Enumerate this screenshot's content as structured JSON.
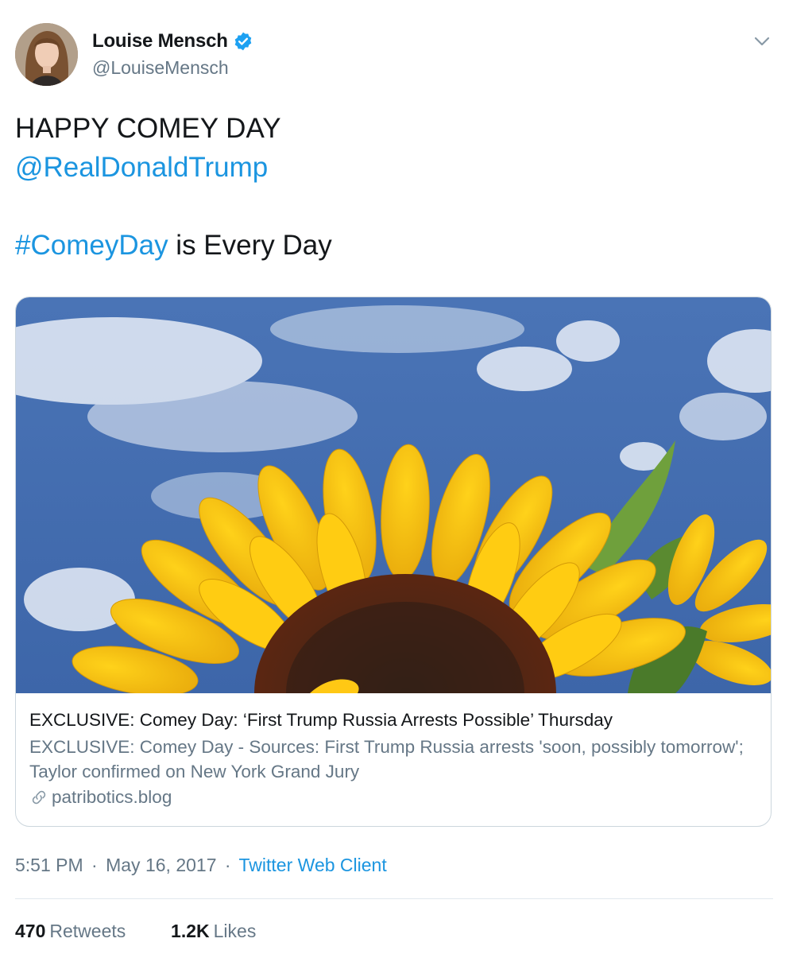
{
  "author": {
    "display_name": "Louise Mensch",
    "handle": "@LouiseMensch",
    "verified": true
  },
  "tweet": {
    "line1": "HAPPY COMEY DAY",
    "mention": "@RealDonaldTrump",
    "hashtag": "#ComeyDay",
    "line3_rest": " is Every Day"
  },
  "card": {
    "title": "EXCLUSIVE: Comey Day: ‘First Trump Russia Arrests Possible’ Thursday",
    "description": "EXCLUSIVE: Comey Day - Sources: First Trump Russia arrests 'soon, possibly tomorrow'; Taylor confirmed on New York Grand Jury",
    "domain": "patribotics.blog"
  },
  "meta": {
    "time": "5:51 PM",
    "separator": "·",
    "date": "May 16, 2017",
    "client": "Twitter Web Client"
  },
  "stats": {
    "retweets_count": "470",
    "retweets_label": "Retweets",
    "likes_count": "1.2K",
    "likes_label": "Likes"
  },
  "colors": {
    "link_blue": "#1b95e0",
    "verified_blue": "#1da1f2",
    "muted_text": "#657786",
    "border": "#ccd6dd"
  },
  "icons": [
    "verified-badge-icon",
    "chevron-down-icon",
    "link-icon"
  ]
}
